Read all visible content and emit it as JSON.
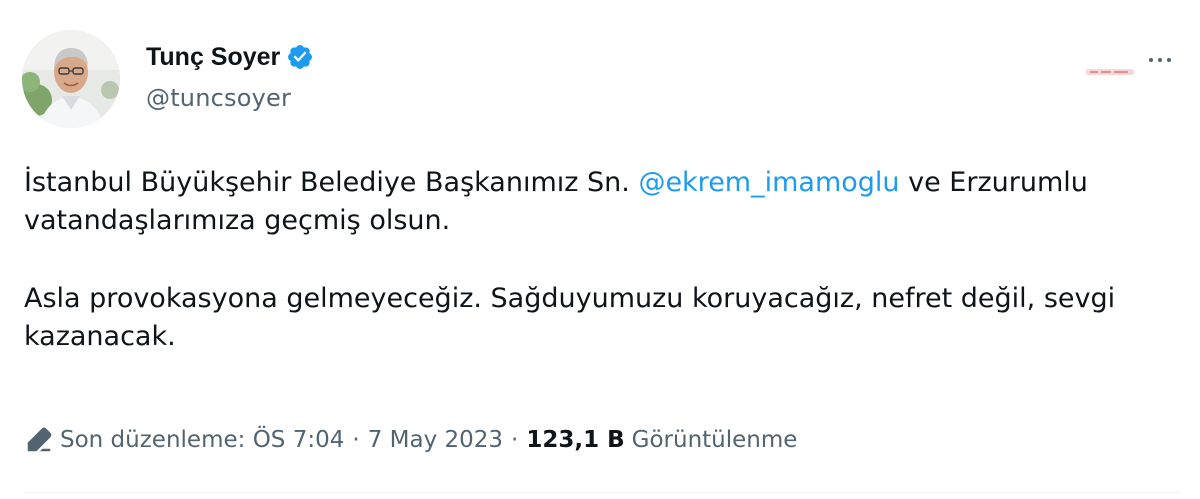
{
  "author": {
    "display_name": "Tunç Soyer",
    "handle": "@tuncsoyer",
    "verified": true,
    "verified_color": "#1d9bf0"
  },
  "tweet": {
    "line1_before": "İstanbul Büyükşehir Belediye Başkanımız Sn. ",
    "mention": "@ekrem_imamoglu",
    "line1_after": " ve Erzurumlu vatandaşlarımıza geçmiş olsun.",
    "paragraph2": "Asla provokasyona gelmeyeceğiz. Sağduyumuzu koruyacağız, nefret değil, sevgi kazanacak."
  },
  "meta": {
    "edited_label": "Son düzenleme:",
    "time": "ÖS 7:04",
    "separator": "·",
    "date": "7 May 2023",
    "views_count": "123,1 B",
    "views_label": "Görüntülenme"
  },
  "colors": {
    "text_primary": "#0f1419",
    "text_secondary": "#536471",
    "link": "#1d9bf0"
  }
}
